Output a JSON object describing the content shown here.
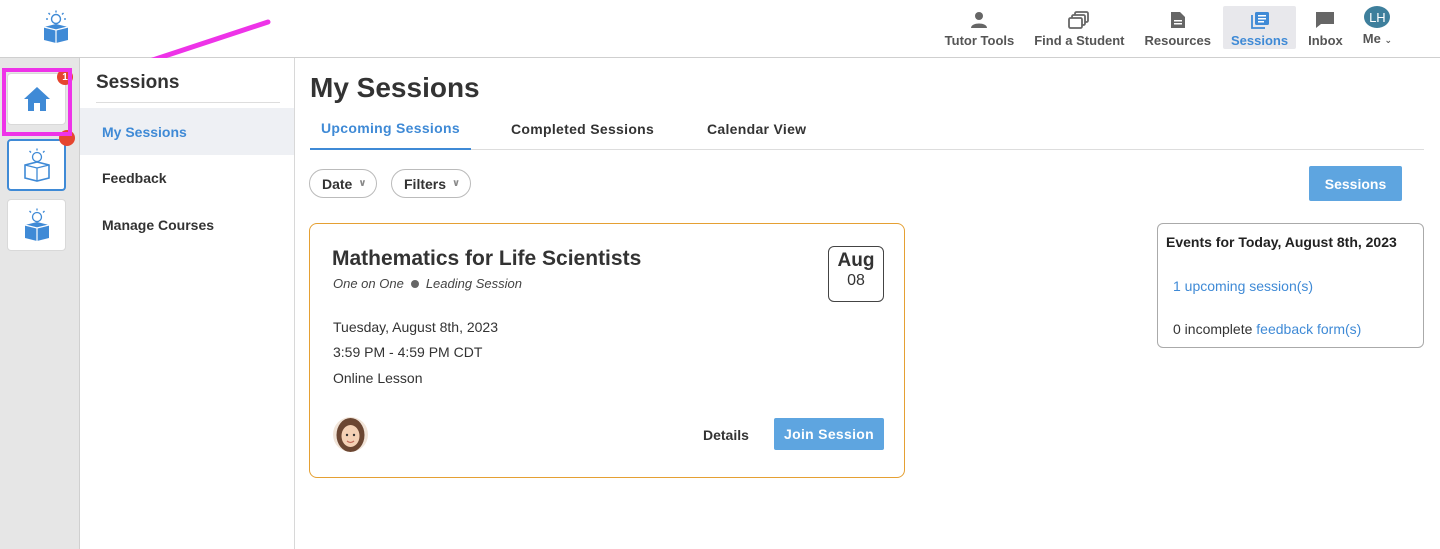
{
  "nav": {
    "items": [
      {
        "label": "Tutor Tools",
        "icon": "person-icon"
      },
      {
        "label": "Find a Student",
        "icon": "cards-icon"
      },
      {
        "label": "Resources",
        "icon": "document-icon"
      },
      {
        "label": "Sessions",
        "icon": "sessions-icon",
        "active": true
      },
      {
        "label": "Inbox",
        "icon": "chat-icon"
      }
    ],
    "me_label": "Me",
    "me_initials": "LH"
  },
  "rail": {
    "badge_home": "1",
    "badge_second": ""
  },
  "sidebar": {
    "title": "Sessions",
    "items": [
      {
        "label": "My Sessions",
        "active": true
      },
      {
        "label": "Feedback"
      },
      {
        "label": "Manage Courses"
      }
    ]
  },
  "main": {
    "title": "My Sessions",
    "tabs": [
      {
        "label": "Upcoming Sessions",
        "active": true
      },
      {
        "label": "Completed Sessions"
      },
      {
        "label": "Calendar View"
      }
    ],
    "filters": {
      "date_label": "Date",
      "filters_label": "Filters"
    },
    "sessions_button": "Sessions"
  },
  "session": {
    "title": "Mathematics for Life Scientists",
    "type": "One on One",
    "role": "Leading Session",
    "month": "Aug",
    "day": "08",
    "date_text": "Tuesday, August 8th, 2023",
    "time_text": "3:59 PM - 4:59 PM CDT",
    "location": "Online Lesson",
    "details_label": "Details",
    "join_label": "Join Session"
  },
  "events": {
    "title": "Events for Today, August 8th, 2023",
    "upcoming_link": "1 upcoming session(s)",
    "incomplete_prefix": "0 incomplete",
    "feedback_link": "feedback form(s)"
  },
  "colors": {
    "accent": "#3f8ad6",
    "button": "#5ea5e0",
    "card_border": "#e5a033",
    "highlight": "#ee33e8",
    "badge": "#e5452f"
  }
}
